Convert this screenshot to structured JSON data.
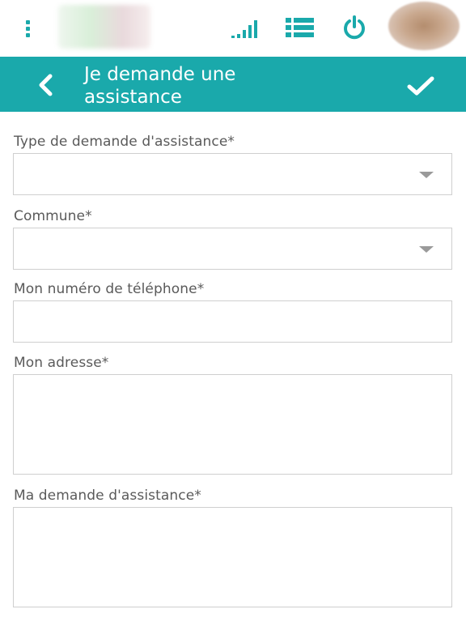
{
  "header": {
    "title": "Je demande une assistance",
    "icons": {
      "menu": "vertical-dots-icon",
      "signal": "signal-bars-icon",
      "list": "list-icon",
      "power": "power-icon",
      "back": "chevron-left-icon",
      "confirm": "checkmark-icon"
    },
    "accent_color": "#1aa9ab"
  },
  "form": {
    "type_label": "Type de demande d'assistance*",
    "type_value": "",
    "commune_label": "Commune*",
    "commune_value": "",
    "phone_label": "Mon numéro de téléphone*",
    "phone_value": "",
    "address_label": "Mon adresse*",
    "address_value": "",
    "request_label": "Ma demande d'assistance*",
    "request_value": ""
  }
}
